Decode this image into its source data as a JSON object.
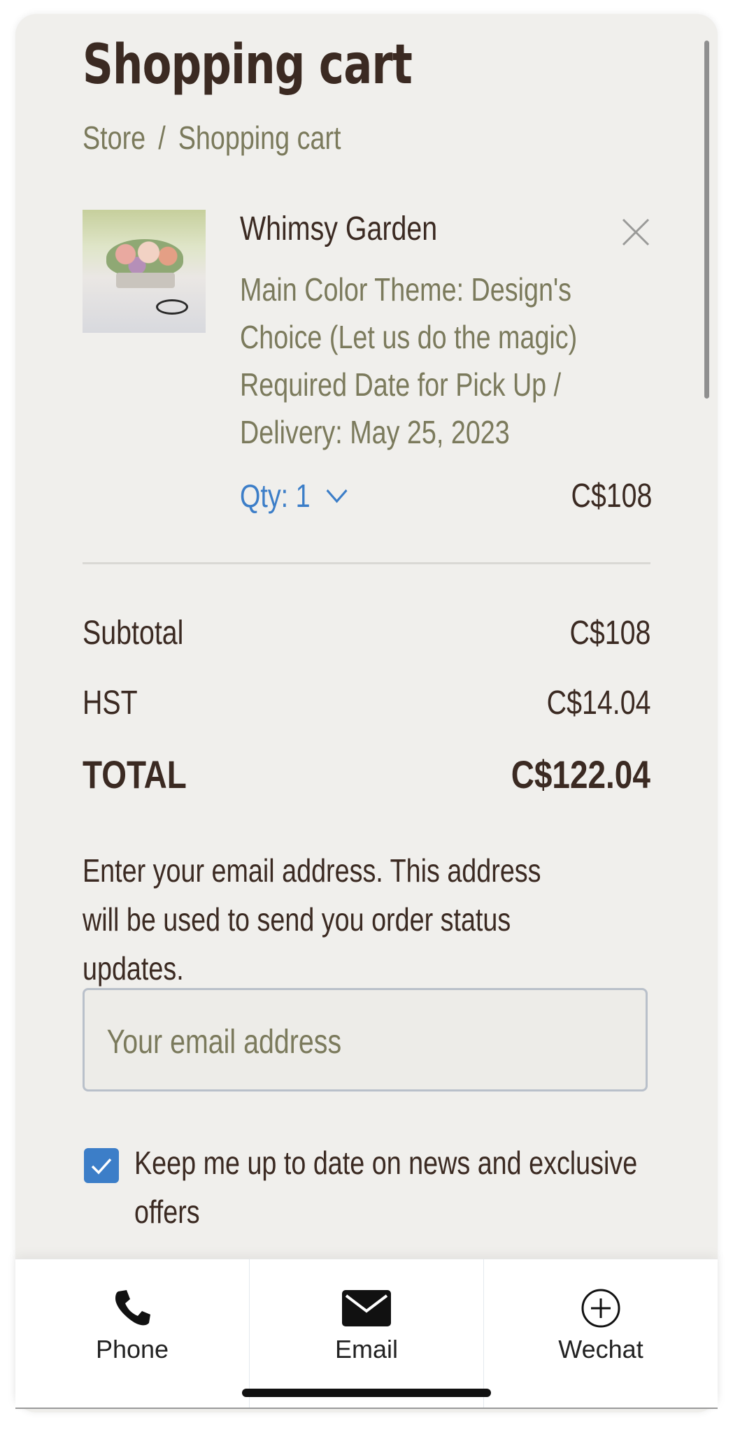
{
  "header": {
    "title": "Shopping cart",
    "breadcrumb": {
      "store": "Store",
      "separator": "/",
      "current": "Shopping cart"
    }
  },
  "cart": {
    "item": {
      "name": "Whimsy Garden",
      "options": [
        "Main Color Theme: Design's Choice (Let us do the magic)",
        "Required Date for Pick Up / Delivery: May 25, 2023"
      ],
      "qty_label": "Qty: 1",
      "price": "C$108",
      "image_icon": "flower-arrangement-thumbnail",
      "remove_icon": "close-icon"
    }
  },
  "summary": {
    "subtotal_label": "Subtotal",
    "subtotal_value": "C$108",
    "tax_label": "HST",
    "tax_value": "C$14.04",
    "total_label": "TOTAL",
    "total_value": "C$122.04"
  },
  "email": {
    "info": "Enter your email address. This address will be used to send you order status updates.",
    "placeholder": "Your email address",
    "value": ""
  },
  "newsletter": {
    "label": "Keep me up to date on news and exclusive offers",
    "checked": true
  },
  "tabbar": {
    "items": [
      {
        "label": "Phone",
        "icon": "phone-icon"
      },
      {
        "label": "Email",
        "icon": "envelope-icon"
      },
      {
        "label": "Wechat",
        "icon": "plus-circle-icon"
      }
    ]
  },
  "colors": {
    "background": "#f0efec",
    "text": "#3b2a22",
    "muted": "#7b7a5c",
    "accent": "#3c7ec8"
  }
}
